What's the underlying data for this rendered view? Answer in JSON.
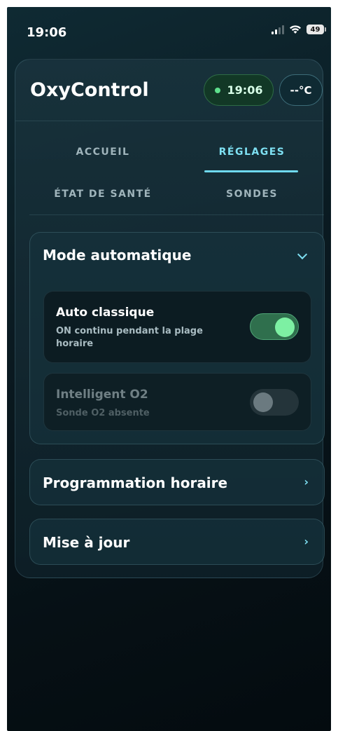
{
  "status_bar": {
    "time": "19:06",
    "battery": "49"
  },
  "app": {
    "title": "OxyControl",
    "clock": "19:06",
    "temperature": "--°C"
  },
  "tabs": [
    {
      "label": "ACCUEIL",
      "active": false
    },
    {
      "label": "RÉGLAGES",
      "active": true
    },
    {
      "label": "ÉTAT DE SANTÉ",
      "active": false
    },
    {
      "label": "SONDES",
      "active": false
    }
  ],
  "auto_mode": {
    "title": "Mode automatique",
    "expanded": true,
    "options": [
      {
        "title": "Auto classique",
        "description": "ON continu pendant la plage horaire",
        "enabled": true
      },
      {
        "title": "Intelligent O2",
        "description": "Sonde O2 absente",
        "enabled": false
      }
    ]
  },
  "sections": {
    "schedule": {
      "title": "Programmation horaire"
    },
    "update": {
      "title": "Mise à jour"
    }
  },
  "colors": {
    "accent": "#7ee0f2",
    "success": "#7df0a3",
    "background": "#0a1a21"
  }
}
